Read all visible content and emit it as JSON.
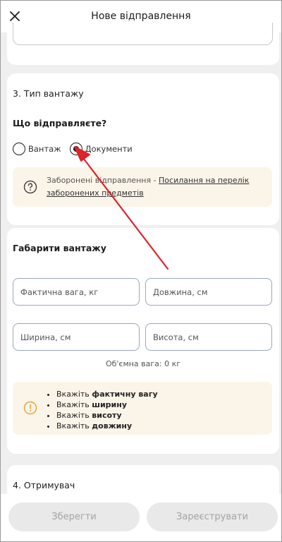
{
  "header": {
    "title": "Нове відправлення"
  },
  "cargo_section": {
    "title": "3. Тип вантажу",
    "question": "Що відправляєте?",
    "options": [
      {
        "label": "Вантаж",
        "selected": false
      },
      {
        "label": "Документи",
        "selected": true
      }
    ],
    "notice": {
      "text": "Заборонені відправлення - ",
      "link": "Посилання на перелік заборонених предметів"
    }
  },
  "dims_section": {
    "title": "Габарити вантажу",
    "fields": {
      "weight": "Фактична вага, кг",
      "length": "Довжина, см",
      "width": "Ширина, см",
      "height": "Висота, см"
    },
    "volumetric": "Об'ємна вага: 0 кг",
    "requirements": [
      {
        "prefix": "Вкажіть ",
        "bold": "фактичну вагу"
      },
      {
        "prefix": "Вкажіть ",
        "bold": "ширину"
      },
      {
        "prefix": "Вкажіть ",
        "bold": "висоту"
      },
      {
        "prefix": "Вкажіть ",
        "bold": "довжину"
      }
    ]
  },
  "recipient_section": {
    "title": "4. Отримувач"
  },
  "footer": {
    "save_label": "Зберегти",
    "register_label": "Зареєструвати"
  },
  "colors": {
    "accent_arrow": "#e0222a",
    "notice_bg": "#fbf5e9",
    "warning_icon": "#e8a33a"
  }
}
